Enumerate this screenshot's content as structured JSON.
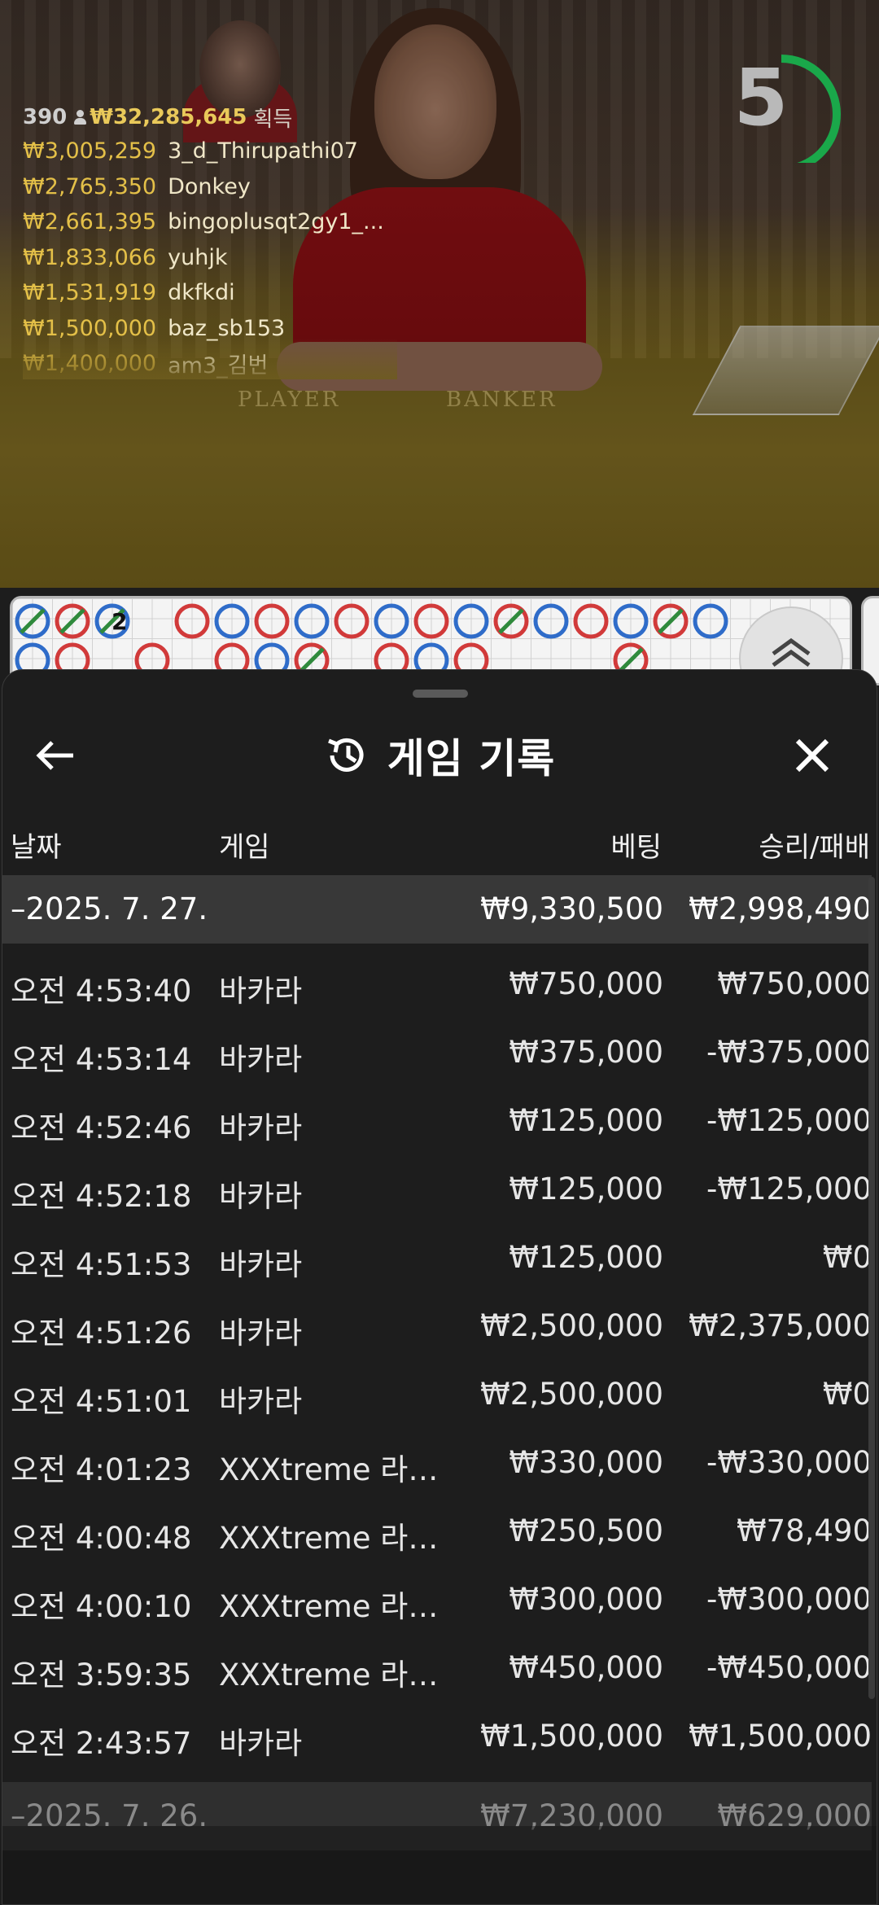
{
  "video": {
    "table_labels": {
      "player": "PLAYER",
      "banker": "BANKER"
    }
  },
  "winners": {
    "player_count": "390",
    "total_amount": "₩32,285,645",
    "earned_label": "획득",
    "list": [
      {
        "amount": "₩3,005,259",
        "name": "3_d_Thirupathi07"
      },
      {
        "amount": "₩2,765,350",
        "name": "Donkey"
      },
      {
        "amount": "₩2,661,395",
        "name": "bingoplusqt2gy1_..."
      },
      {
        "amount": "₩1,833,066",
        "name": "yuhjk"
      },
      {
        "amount": "₩1,531,919",
        "name": "dkfkdi"
      },
      {
        "amount": "₩1,500,000",
        "name": "baz_sb153"
      },
      {
        "amount": "₩1,400,000",
        "name": "am3_김번"
      }
    ]
  },
  "timer": {
    "seconds": "5",
    "progress": 0.45,
    "color": "#1aa84a"
  },
  "roadmap": {
    "colors": {
      "player": "#2f6cc9",
      "banker": "#d13a3a",
      "tie": "#2f8a3c"
    },
    "overlay_number": "2"
  },
  "history": {
    "title": "게임 기록",
    "columns": {
      "date": "날짜",
      "game": "게임",
      "bet": "베팅",
      "result": "승리/패배"
    },
    "groups": [
      {
        "date": "–2025. 7. 27.",
        "bet_total": "₩9,330,500",
        "result_total": "₩2,998,490",
        "rows": [
          {
            "time": "오전 4:53:40",
            "game": "바카라",
            "bet": "₩750,000",
            "result": "₩750,000"
          },
          {
            "time": "오전 4:53:14",
            "game": "바카라",
            "bet": "₩375,000",
            "result": "-₩375,000"
          },
          {
            "time": "오전 4:52:46",
            "game": "바카라",
            "bet": "₩125,000",
            "result": "-₩125,000"
          },
          {
            "time": "오전 4:52:18",
            "game": "바카라",
            "bet": "₩125,000",
            "result": "-₩125,000"
          },
          {
            "time": "오전 4:51:53",
            "game": "바카라",
            "bet": "₩125,000",
            "result": "₩0"
          },
          {
            "time": "오전 4:51:26",
            "game": "바카라",
            "bet": "₩2,500,000",
            "result": "₩2,375,000"
          },
          {
            "time": "오전 4:51:01",
            "game": "바카라",
            "bet": "₩2,500,000",
            "result": "₩0"
          },
          {
            "time": "오전 4:01:23",
            "game": "XXXtreme 라이...",
            "bet": "₩330,000",
            "result": "-₩330,000"
          },
          {
            "time": "오전 4:00:48",
            "game": "XXXtreme 라이...",
            "bet": "₩250,500",
            "result": "₩78,490"
          },
          {
            "time": "오전 4:00:10",
            "game": "XXXtreme 라이...",
            "bet": "₩300,000",
            "result": "-₩300,000"
          },
          {
            "time": "오전 3:59:35",
            "game": "XXXtreme 라이...",
            "bet": "₩450,000",
            "result": "-₩450,000"
          },
          {
            "time": "오전 2:43:57",
            "game": "바카라",
            "bet": "₩1,500,000",
            "result": "₩1,500,000"
          }
        ]
      },
      {
        "date": "–2025. 7. 26.",
        "bet_total": "₩7,230,000",
        "result_total": "₩629,000",
        "rows": []
      }
    ]
  }
}
